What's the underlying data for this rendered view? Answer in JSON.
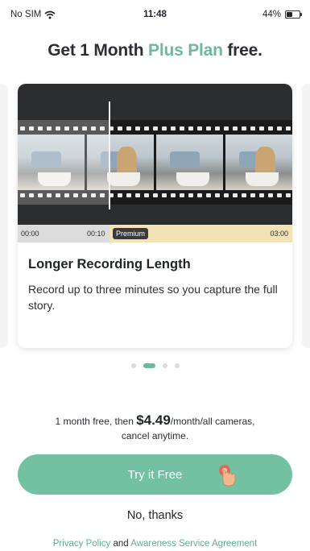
{
  "status_bar": {
    "carrier": "No SIM",
    "time": "11:48",
    "battery_text": "44%",
    "battery_level": 0.44
  },
  "headline": {
    "prefix": "Get 1 Month ",
    "accent": "Plus Plan",
    "suffix": " free.",
    "accent_color": "#6fb89b"
  },
  "card": {
    "timeline": {
      "start": "00:00",
      "free_end": "00:10",
      "badge": "Premium",
      "end": "03:00"
    },
    "title": "Longer Recording Length",
    "body": "Record up to three minutes so you capture the full story."
  },
  "pager": {
    "count": 4,
    "active_index": 1
  },
  "offer": {
    "line1_prefix": "1 month free, then ",
    "price": "$4.49",
    "line1_suffix": "/month/all cameras,",
    "line2": "cancel anytime."
  },
  "actions": {
    "try_label": "Try it Free",
    "decline_label": "No, thanks"
  },
  "legal": {
    "privacy_link": "Privacy Policy",
    "joiner": " and ",
    "agreement_link": "Awareness Service Agreement"
  },
  "colors": {
    "accent": "#74c0a2",
    "link": "#5fae8f"
  }
}
